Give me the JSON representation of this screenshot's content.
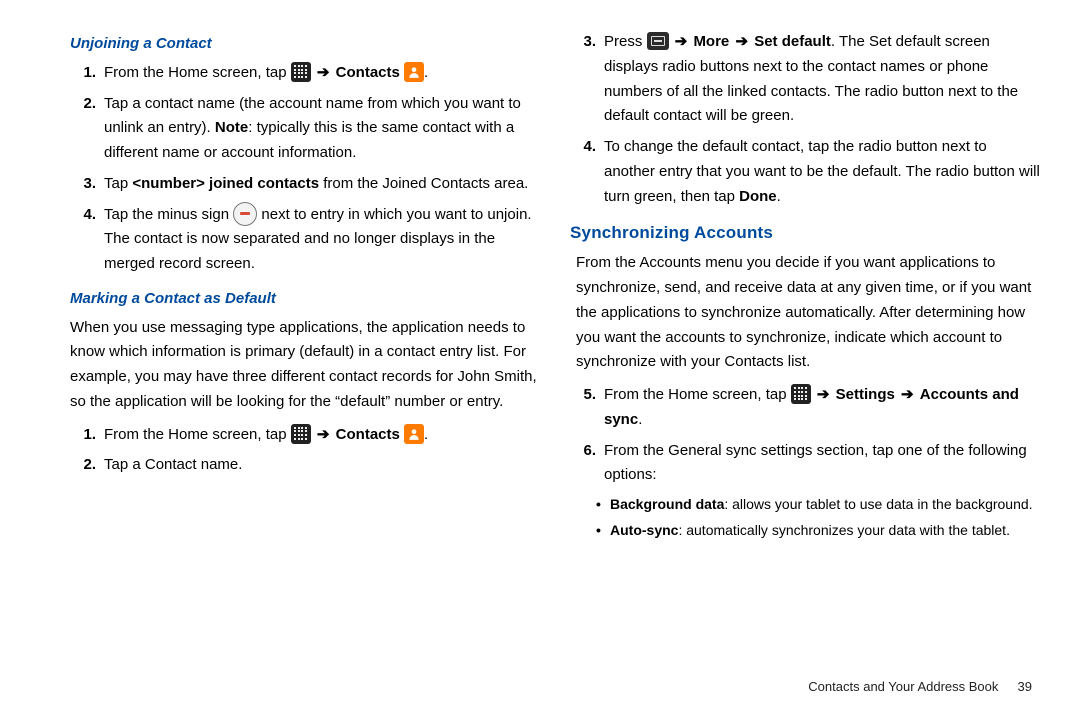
{
  "arrow": "➔",
  "left": {
    "unjoin_title": "Unjoining a Contact",
    "unjoin_steps": {
      "s1a": "From the Home screen, tap ",
      "s1b": "Contacts",
      "s1c": ".",
      "s2a": "Tap a contact name (the account name from which you want to unlink an entry). ",
      "s2_note_label": "Note",
      "s2b": ": typically this is the same contact with a different name or account information.",
      "s3a": "Tap ",
      "s3b": "<number> joined contacts",
      "s3c": " from the Joined Contacts area.",
      "s4a": "Tap the minus sign ",
      "s4b": " next to entry in which you want to unjoin. The contact is now separated and no longer displays in the merged record screen."
    },
    "marking_title": "Marking a Contact as Default",
    "marking_para": "When you use messaging type applications, the application needs to know which information is primary (default) in a contact entry list. For example, you may have three different contact records for John Smith, so the application will be looking for the “default” number or entry.",
    "marking_steps": {
      "s1a": "From the Home screen, tap ",
      "s1b": "Contacts",
      "s1c": ".",
      "s2": "Tap a Contact name."
    }
  },
  "right": {
    "steps_cont": {
      "s3a": "Press ",
      "s3b": "More",
      "s3c": "Set default",
      "s3d": ". The Set default screen displays radio buttons next to the contact names or phone numbers of all the linked contacts. The radio button next to the default contact will be green.",
      "s4a": "To change the default contact, tap the radio button next to another entry that you want to be the default. The radio button will turn green, then tap ",
      "s4b": "Done",
      "s4c": "."
    },
    "sync_title": "Synchronizing Accounts",
    "sync_para": "From the Accounts menu you decide if you want applications to synchronize, send, and receive data at any given time, or if you want the applications to synchronize automatically. After determining how you want the accounts to synchronize, indicate which account to synchronize with your Contacts list.",
    "sync_steps": {
      "s5a": "From the Home screen, tap ",
      "s5b": "Settings",
      "s5c": "Accounts and sync",
      "s5d": ".",
      "s6": "From the General sync settings section, tap one of the following options:"
    },
    "bullets": {
      "b1_label": "Background data",
      "b1_text": ": allows your tablet to use data in the background.",
      "b2_label": "Auto-sync",
      "b2_text": ": automatically synchronizes your data with the tablet."
    }
  },
  "footer": {
    "section": "Contacts and Your Address Book",
    "page": "39"
  }
}
